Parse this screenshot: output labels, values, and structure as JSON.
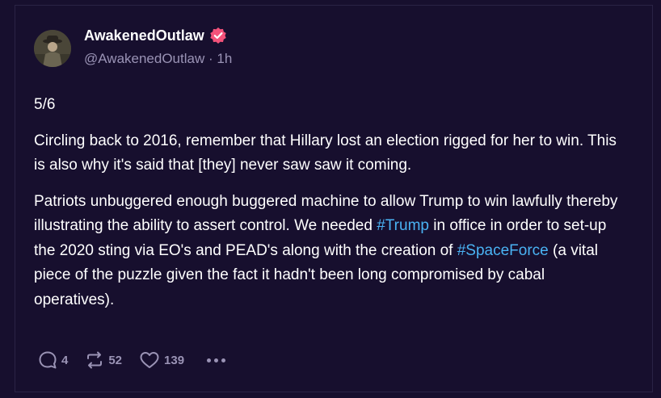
{
  "post": {
    "author": {
      "display_name": "AwakenedOutlaw",
      "handle": "@AwakenedOutlaw",
      "separator": "·",
      "time_ago": "1h",
      "verified_badge_color": "#f4527a"
    },
    "content": {
      "para1": "5/6",
      "para2": "Circling back to 2016, remember that Hillary lost an election rigged for her to win. This is also why it's said that [they] never saw saw it coming.",
      "para3_part1": "Patriots unbuggered enough buggered machine to allow Trump to win lawfully thereby illustrating the ability to assert control.  We needed ",
      "hashtag1": "#Trump",
      "para3_part2": " in office in order to set-up the 2020 sting via EO's and PEAD's along with the creation of ",
      "hashtag2": "#SpaceForce",
      "para3_part3": " (a vital piece of the puzzle given the fact it hadn't been long compromised by cabal operatives)."
    },
    "actions": {
      "replies": "4",
      "reposts": "52",
      "likes": "139",
      "reply_icon": "comment-icon",
      "repost_icon": "repost-icon",
      "like_icon": "heart-icon",
      "more_icon": "more-icon"
    }
  },
  "colors": {
    "background": "#170f2e",
    "secondary_text": "#9a93b5",
    "hashtag": "#4ab3f4"
  }
}
